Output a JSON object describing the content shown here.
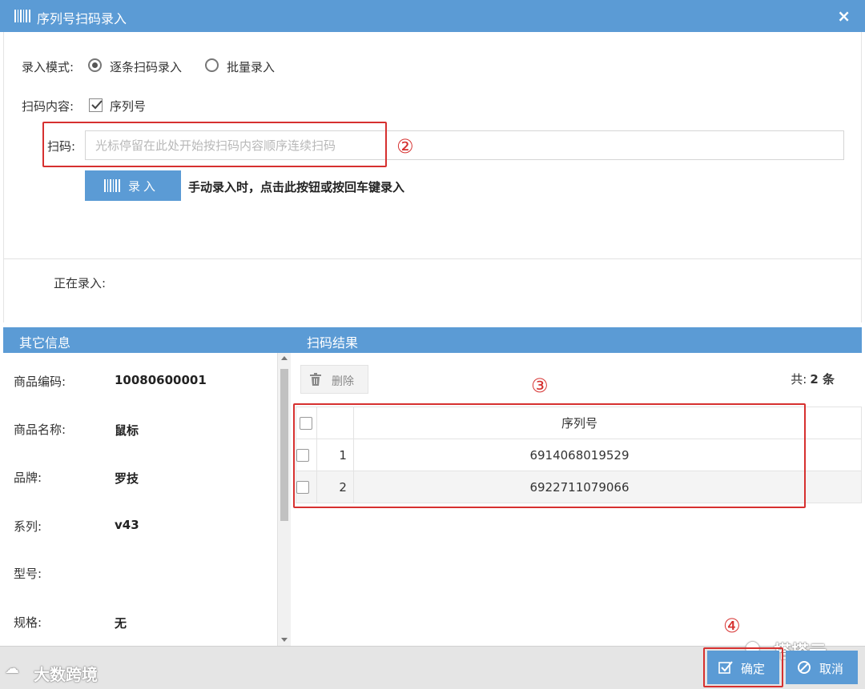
{
  "dialog": {
    "title": "序列号扫码录入",
    "close": "×"
  },
  "mode": {
    "label": "录入模式:",
    "options": [
      {
        "label": "逐条扫码录入",
        "selected": true
      },
      {
        "label": "批量录入",
        "selected": false
      }
    ]
  },
  "scan_content": {
    "label": "扫码内容:",
    "checkbox_label": "序列号",
    "checked": true
  },
  "scan": {
    "label": "扫码:",
    "value": "",
    "placeholder": "光标停留在此处开始按扫码内容顺序连续扫码"
  },
  "enter_button": {
    "label": "录入"
  },
  "hint": "手动录入时，点击此按钮或按回车键录入",
  "entering_label": "正在录入:",
  "annotations": [
    "②",
    "③",
    "④"
  ],
  "other_info": {
    "title": "其它信息",
    "fields": [
      {
        "label": "商品编码:",
        "value": "10080600001"
      },
      {
        "label": "商品名称:",
        "value": "鼠标"
      },
      {
        "label": "品牌:",
        "value": "罗技"
      },
      {
        "label": "系列:",
        "value": "v43"
      },
      {
        "label": "型号:",
        "value": ""
      },
      {
        "label": "规格:",
        "value": "无"
      }
    ]
  },
  "scan_result": {
    "title": "扫码结果",
    "delete_label": "删除",
    "total_prefix": "共:",
    "total_value": "2 条",
    "column_header": "序列号",
    "rows": [
      {
        "no": "1",
        "serial": "6914068019529"
      },
      {
        "no": "2",
        "serial": "6922711079066"
      }
    ]
  },
  "footer": {
    "ok_label": "确定",
    "cancel_label": "取消",
    "watermark_left": "大数跨境",
    "watermark_right": "搭搭云"
  },
  "colors": {
    "accent": "#5b9bd5",
    "annotation_red": "#d6302f"
  }
}
